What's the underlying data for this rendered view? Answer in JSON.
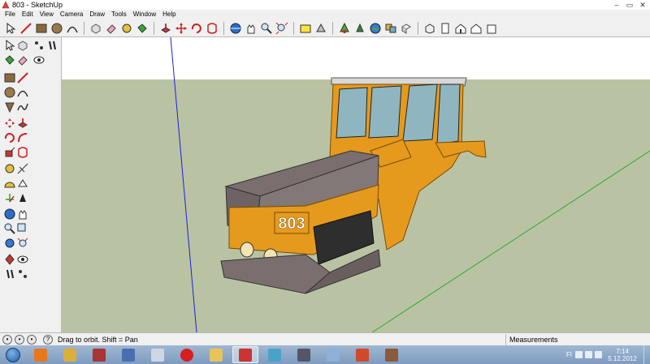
{
  "window": {
    "title": "803 - SketchUp",
    "controls": {
      "minimize": "–",
      "maximize": "▭",
      "close": "✕"
    }
  },
  "menu": [
    "File",
    "Edit",
    "View",
    "Camera",
    "Draw",
    "Tools",
    "Window",
    "Help"
  ],
  "status": {
    "hint": "Drag to orbit.  Shift = Pan",
    "measurements_label": "Measurements"
  },
  "model": {
    "badge_text": "803"
  },
  "taskbar": {
    "language": "FI",
    "clock_time": "7:14",
    "clock_date": "5.12.2012"
  },
  "colors": {
    "sky": "#ffffff",
    "ground": "#b9c3a4",
    "axis_blue": "#1f1fd8",
    "axis_green": "#2fa82f",
    "body_orange": "#e79b1c",
    "roof_gray": "#7a6e6e"
  }
}
